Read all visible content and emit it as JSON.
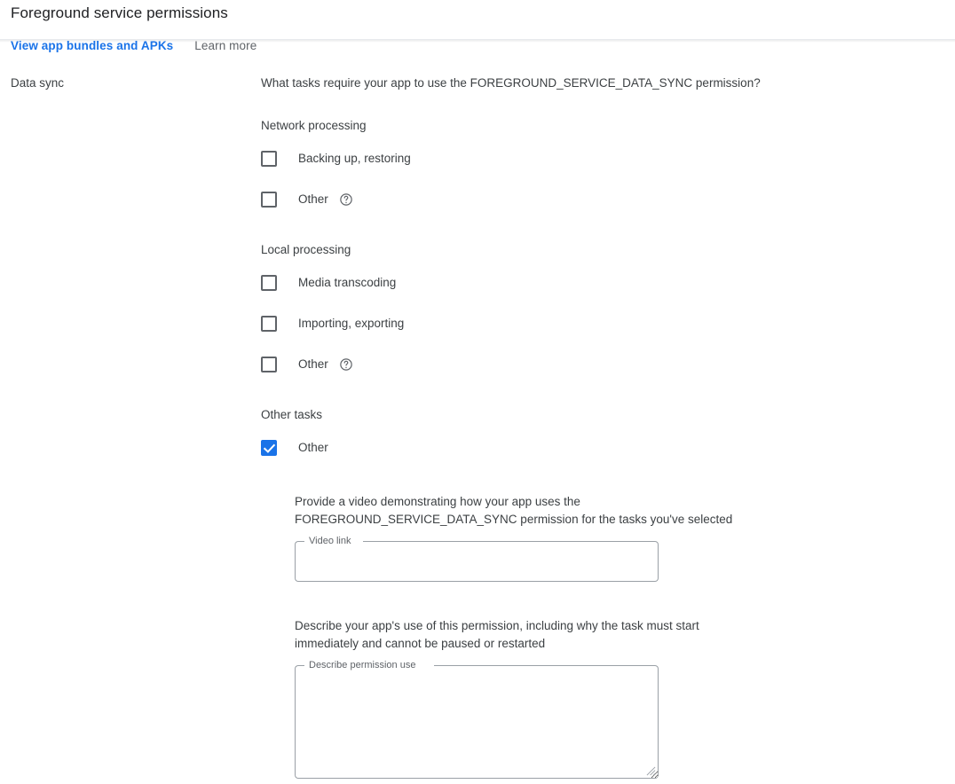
{
  "header": {
    "title": "Foreground service permissions",
    "links": [
      {
        "label": "View app bundles and APKs",
        "style": "primary"
      },
      {
        "label": "Learn more",
        "style": "secondary"
      }
    ]
  },
  "colors": {
    "accent": "#1a73e8",
    "link": "#1a73e8",
    "text": "#3c4043",
    "title": "#202124",
    "muted": "#5f6368",
    "border": "#9aa0a6",
    "divider": "#e8eaed",
    "background": "#ffffff"
  },
  "section": {
    "label": "Data sync",
    "question": "What tasks require your app to use the FOREGROUND_SERVICE_DATA_SYNC permission?"
  },
  "groups": [
    {
      "title": "Network processing",
      "options": [
        {
          "label": "Backing up, restoring",
          "checked": false,
          "help": false
        },
        {
          "label": "Other",
          "checked": false,
          "help": true,
          "help_icon": "help-circle-icon"
        }
      ]
    },
    {
      "title": "Local processing",
      "options": [
        {
          "label": "Media transcoding",
          "checked": false,
          "help": false
        },
        {
          "label": "Importing, exporting",
          "checked": false,
          "help": false
        },
        {
          "label": "Other",
          "checked": false,
          "help": true,
          "help_icon": "help-circle-icon"
        }
      ]
    },
    {
      "title": "Other tasks",
      "options": [
        {
          "label": "Other",
          "checked": true,
          "help": false
        }
      ]
    }
  ],
  "subform": {
    "video": {
      "prompt": "Provide a video demonstrating how your app uses the FOREGROUND_SERVICE_DATA_SYNC permission for the tasks you've selected",
      "label": "Video link",
      "value": "",
      "placeholder": ""
    },
    "describe": {
      "prompt": "Describe your app's use of this permission, including why the task must start immediately and cannot be paused or restarted",
      "label": "Describe permission use",
      "value": "",
      "placeholder": ""
    }
  }
}
